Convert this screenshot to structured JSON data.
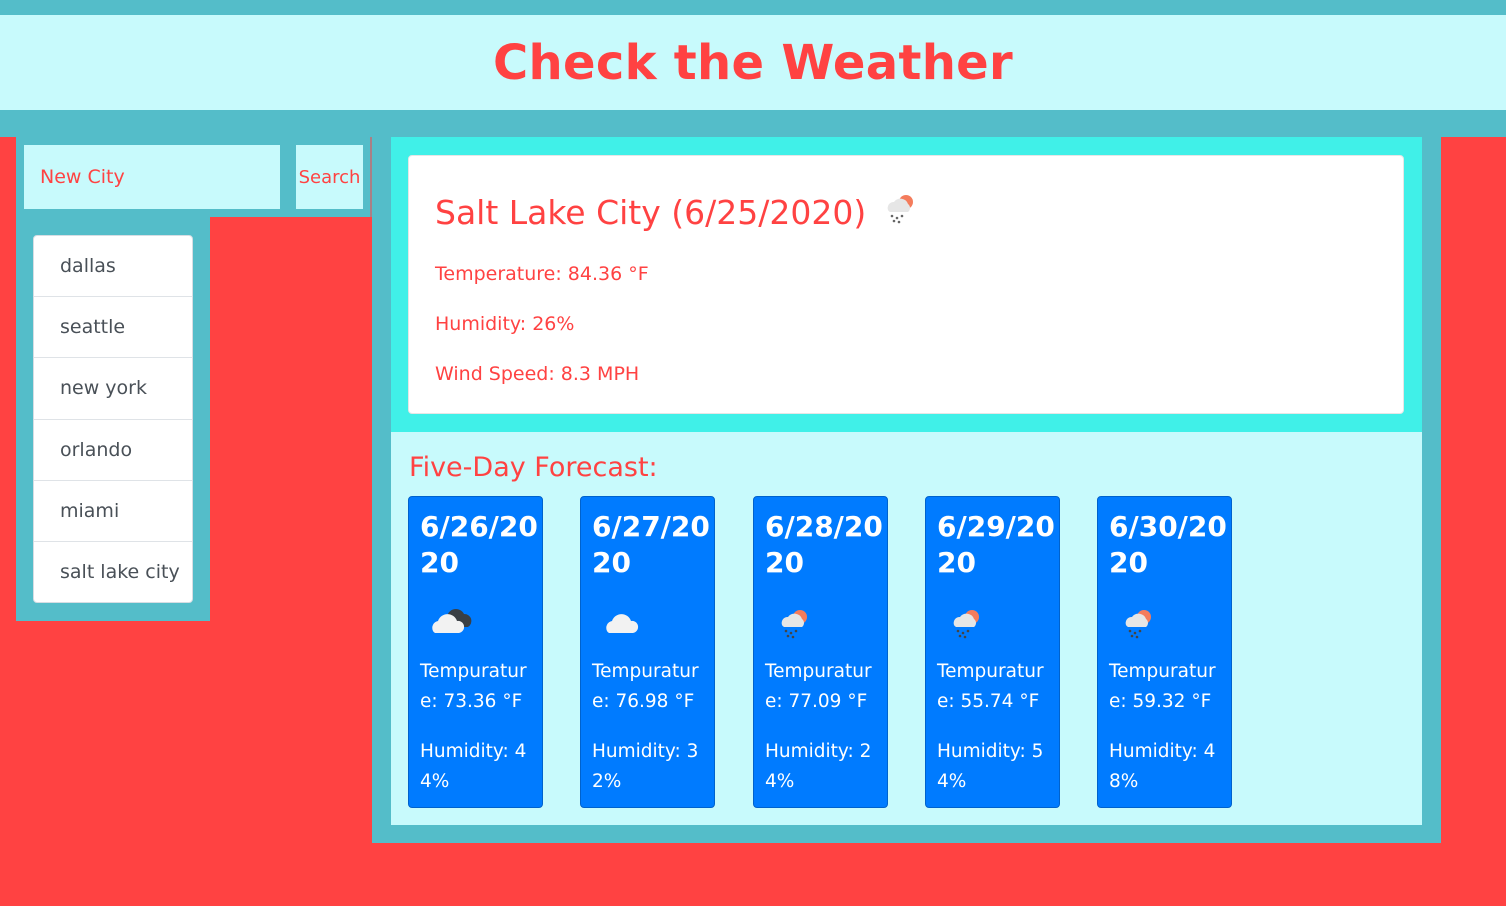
{
  "header": {
    "title": "Check the Weather"
  },
  "search": {
    "placeholder": "New City",
    "button_label": "Search"
  },
  "history": [
    "dallas",
    "seattle",
    "new york",
    "orlando",
    "miami",
    "salt lake city"
  ],
  "current": {
    "title": "Salt Lake City (6/25/2020)",
    "icon": "rain-sun-icon",
    "temperature": "Temperature: 84.36 °F",
    "humidity": "Humidity: 26%",
    "wind": "Wind Speed: 8.3 MPH"
  },
  "forecast": {
    "title": "Five-Day Forecast:",
    "days": [
      {
        "date": "6/26/2020",
        "icon": "broken-clouds-icon",
        "temp": "Tempurature: 73.36 °F",
        "humidity": "Humidity: 44%"
      },
      {
        "date": "6/27/2020",
        "icon": "cloud-icon",
        "temp": "Tempurature: 76.98 °F",
        "humidity": "Humidity: 32%"
      },
      {
        "date": "6/28/2020",
        "icon": "rain-sun-icon",
        "temp": "Tempurature: 77.09 °F",
        "humidity": "Humidity: 24%"
      },
      {
        "date": "6/29/2020",
        "icon": "rain-sun-icon",
        "temp": "Tempurature: 55.74 °F",
        "humidity": "Humidity: 54%"
      },
      {
        "date": "6/30/2020",
        "icon": "rain-sun-icon",
        "temp": "Tempurature: 59.32 °F",
        "humidity": "Humidity: 48%"
      }
    ]
  },
  "colors": {
    "accent": "#ff4242",
    "teal": "#54bdc9",
    "light_cyan": "#c8fafc",
    "bright_cyan": "#40f0e8",
    "card_blue": "#007bff"
  }
}
